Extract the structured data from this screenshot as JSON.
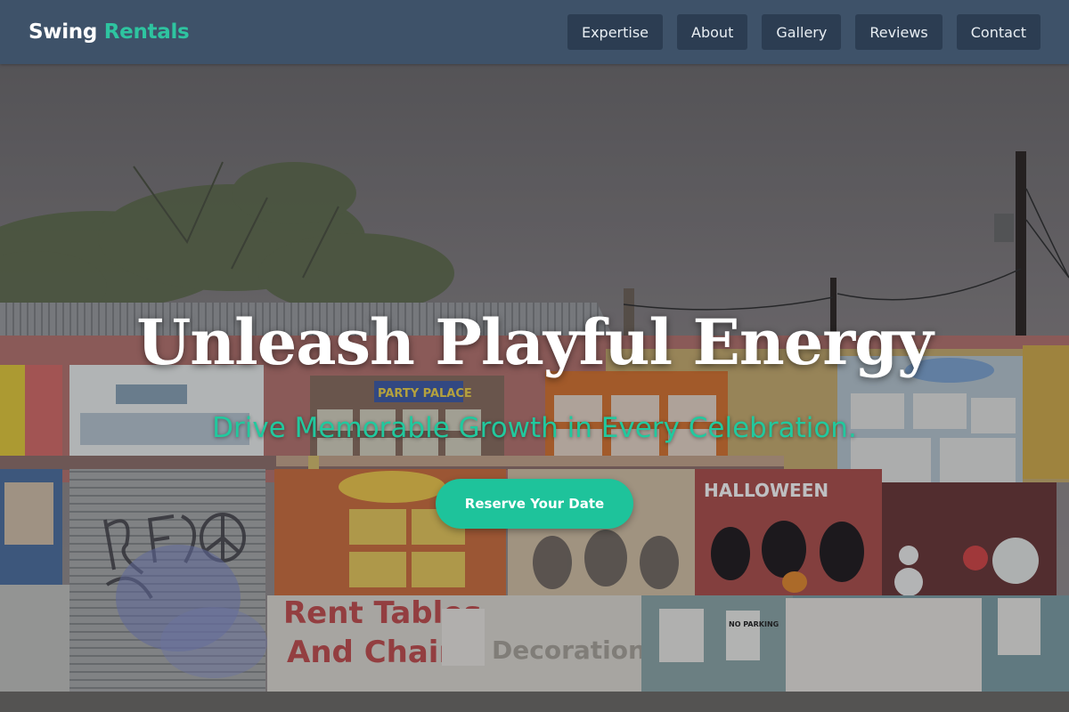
{
  "brand": {
    "name": "Swing",
    "accent": "Rentals",
    "accent_color": "#2ec4a0"
  },
  "nav": {
    "items": [
      {
        "label": "Expertise"
      },
      {
        "label": "About"
      },
      {
        "label": "Gallery"
      },
      {
        "label": "Reviews"
      },
      {
        "label": "Contact"
      }
    ]
  },
  "hero": {
    "headline": "Unleash Playful Energy",
    "subheadline": "Drive Memorable Growth in Every Celebration.",
    "cta_label": "Reserve Your Date",
    "background": {
      "description_signs": {
        "party_palace": "PARTY PALACE",
        "halloween": "HALLOWEEN",
        "rent_tables": "Rent Tables",
        "and_chairs": "And Chairs",
        "decoration": "Decoration",
        "no_parking": "NO PARKING"
      }
    }
  }
}
